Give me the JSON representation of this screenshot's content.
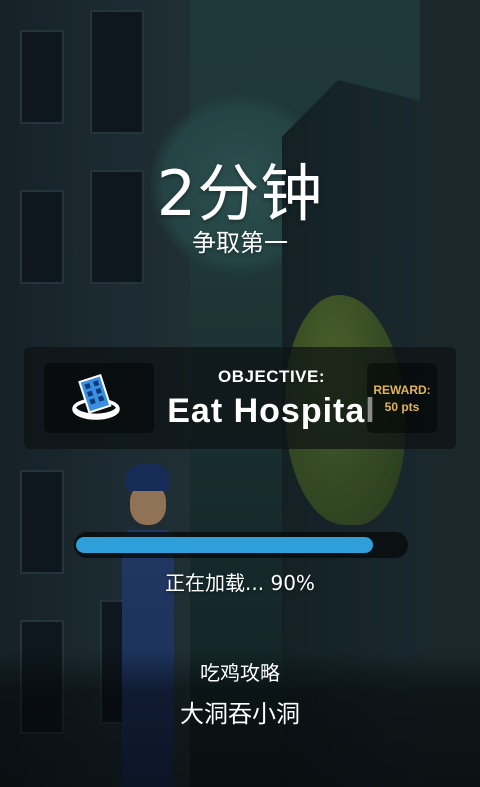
{
  "loading_screen": {
    "title": "2分钟",
    "subtitle": "争取第一"
  },
  "objective": {
    "label": "OBJECTIVE:",
    "value": "Eat Hospital",
    "icon": "hospital-building-icon",
    "reward_label": "REWARD:",
    "reward_value": "50 pts"
  },
  "progress": {
    "fraction": 0.9,
    "text": "正在加载... 90%"
  },
  "tip": {
    "heading": "吃鸡攻略",
    "body": "大洞吞小洞"
  },
  "colors": {
    "progress_fill": "#2f9fd9",
    "reward_text": "#e2b45a",
    "panel_background": "#0c1214"
  }
}
